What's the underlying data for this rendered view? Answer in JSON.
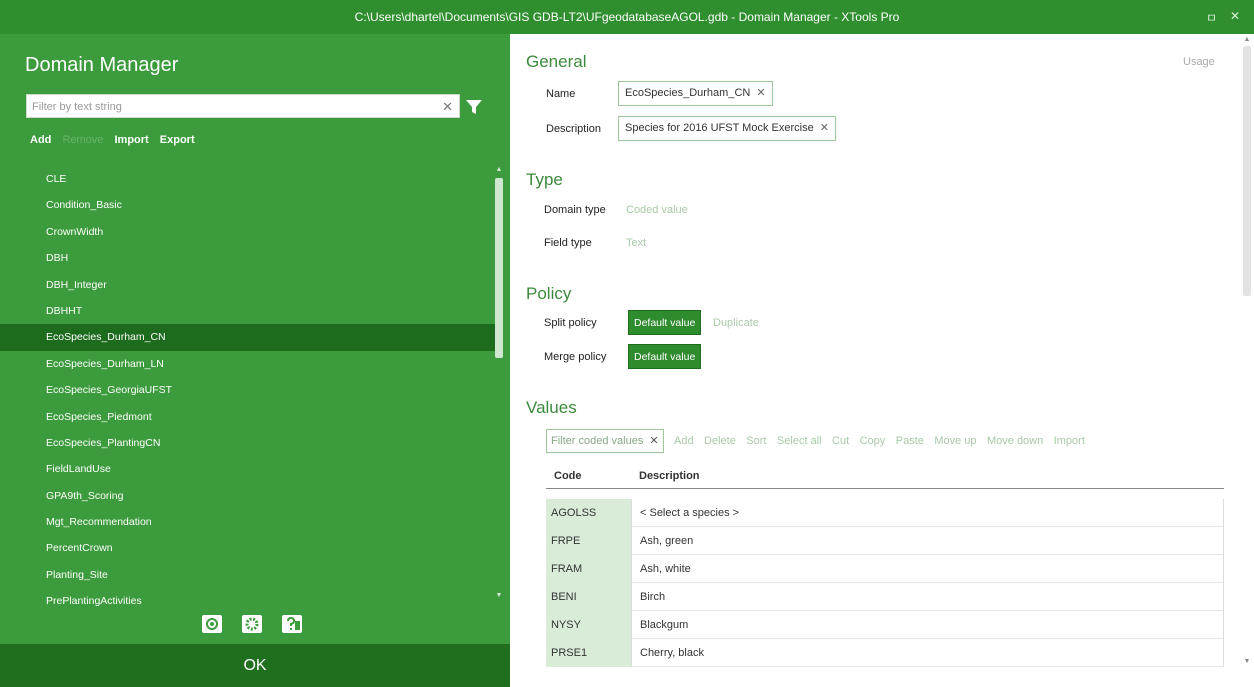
{
  "window": {
    "title": "C:\\Users\\dhartel\\Documents\\GIS GDB-LT2\\UFgeodatabaseAGOL.gdb - Domain Manager - XTools Pro",
    "minimize_glyph": "ㅁ",
    "close_glyph": "✕"
  },
  "left": {
    "title": "Domain Manager",
    "filter_placeholder": "Filter by text string",
    "actions": {
      "add": "Add",
      "remove": "Remove",
      "import": "Import",
      "export": "Export"
    },
    "domains": [
      "CLE",
      "Condition_Basic",
      "CrownWidth",
      "DBH",
      "DBH_Integer",
      "DBHHT",
      "EcoSpecies_Durham_CN",
      "EcoSpecies_Durham_LN",
      "EcoSpecies_GeorgiaUFST",
      "EcoSpecies_Piedmont",
      "EcoSpecies_PlantingCN",
      "FieldLandUse",
      "GPA9th_Scoring",
      "Mgt_Recommendation",
      "PercentCrown",
      "Planting_Site",
      "PrePlantingActivities"
    ],
    "selected_index": 6,
    "ok_label": "OK"
  },
  "right": {
    "usage_label": "Usage",
    "general": {
      "heading": "General",
      "name_label": "Name",
      "name_value": "EcoSpecies_Durham_CN",
      "description_label": "Description",
      "description_value": "Species for 2016 UFST Mock Exercise"
    },
    "type": {
      "heading": "Type",
      "domain_type_label": "Domain type",
      "domain_type_value": "Coded value",
      "field_type_label": "Field type",
      "field_type_value": "Text"
    },
    "policy": {
      "heading": "Policy",
      "split_label": "Split policy",
      "split_selected": "Default value",
      "split_other": "Duplicate",
      "merge_label": "Merge policy",
      "merge_selected": "Default value"
    },
    "values": {
      "heading": "Values",
      "filter_placeholder": "Filter coded values",
      "tools": [
        "Add",
        "Delete",
        "Sort",
        "Select all",
        "Cut",
        "Copy",
        "Paste",
        "Move up",
        "Move down",
        "Import"
      ],
      "columns": {
        "code": "Code",
        "description": "Description"
      },
      "rows": [
        {
          "code": "AGOLSS",
          "description": "< Select a species >"
        },
        {
          "code": "FRPE",
          "description": "Ash, green"
        },
        {
          "code": "FRAM",
          "description": "Ash, white"
        },
        {
          "code": "BENI",
          "description": "Birch"
        },
        {
          "code": "NYSY",
          "description": "Blackgum"
        },
        {
          "code": "PRSE1",
          "description": "Cherry, black"
        }
      ]
    }
  },
  "colors": {
    "panel_green": "#3c9b3c",
    "title_green": "#2f8f2f",
    "selected_green": "#1d6b1d",
    "ok_green": "#1f6f1f",
    "accent_text": "#3c8a3c"
  }
}
